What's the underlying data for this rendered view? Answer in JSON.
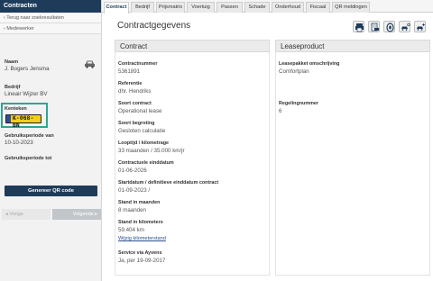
{
  "sidebar": {
    "title": "Contracten",
    "links": [
      "‹ Terug naar zoekresultaten",
      "‹ Medewerker"
    ],
    "name_label": "Naam",
    "name_value": "J. Bogers Jensma",
    "company_label": "Bedrijf",
    "company_value": "Lineair Wijzer BV",
    "plate_label": "Kenteken",
    "plate_value": "K-068-BN",
    "period_from_label": "Gebruiksperiode van",
    "period_from_value": "10-10-2023",
    "period_to_label": "Gebruiksperiode tot",
    "qr_button": "Genereer QR code",
    "prev_button": "◂ Vorige",
    "next_button": "Volgende ▸"
  },
  "tabs": [
    "Contract",
    "Bedrijf",
    "Prijsmatrix",
    "Voertuig",
    "Passen",
    "Schade",
    "Onderhoud",
    "Fiscaal",
    "QR meldingen"
  ],
  "active_tab": "Contract",
  "page_title": "Contractgegevens",
  "toolbar_icons": [
    "print-icon",
    "vehicle-document-icon",
    "tire-icon",
    "car-key-icon",
    "car-add-icon"
  ],
  "contract": {
    "heading": "Contract",
    "fields": [
      {
        "label": "Contractnummer",
        "value": "5361891"
      },
      {
        "label": "Referentie",
        "value": "dhr. Hendriks"
      },
      {
        "label": "Soort contract",
        "value": "Operational lease"
      },
      {
        "label": "Soort begroting",
        "value": "Gesloten calculatie"
      },
      {
        "label": "Looptijd / kilometrage",
        "value": "33 maanden / 35.000 km/jr"
      },
      {
        "label": "Contractuele einddatum",
        "value": "01-06-2026"
      },
      {
        "label": "Startdatum / definitieve einddatum contract",
        "value": "01-09-2023 /"
      },
      {
        "label": "Stand in maanden",
        "value": "8 maanden"
      },
      {
        "label": "Stand in kilometers",
        "value": "59.404 km"
      },
      {
        "label": "Service via Ayvens",
        "value": "Ja, per 19-09-2017"
      }
    ],
    "km_link": "Wijzig kilometerstand"
  },
  "leaseproduct": {
    "heading": "Leaseproduct",
    "fields": [
      {
        "label": "Leasepakket omschrijving",
        "value": "Comfortplan"
      },
      {
        "label": "Regelingnummer",
        "value": "6"
      }
    ]
  },
  "colors": {
    "navy": "#1e3c5a",
    "highlight": "#2fa592",
    "plate_yellow": "#f3cf1c"
  }
}
